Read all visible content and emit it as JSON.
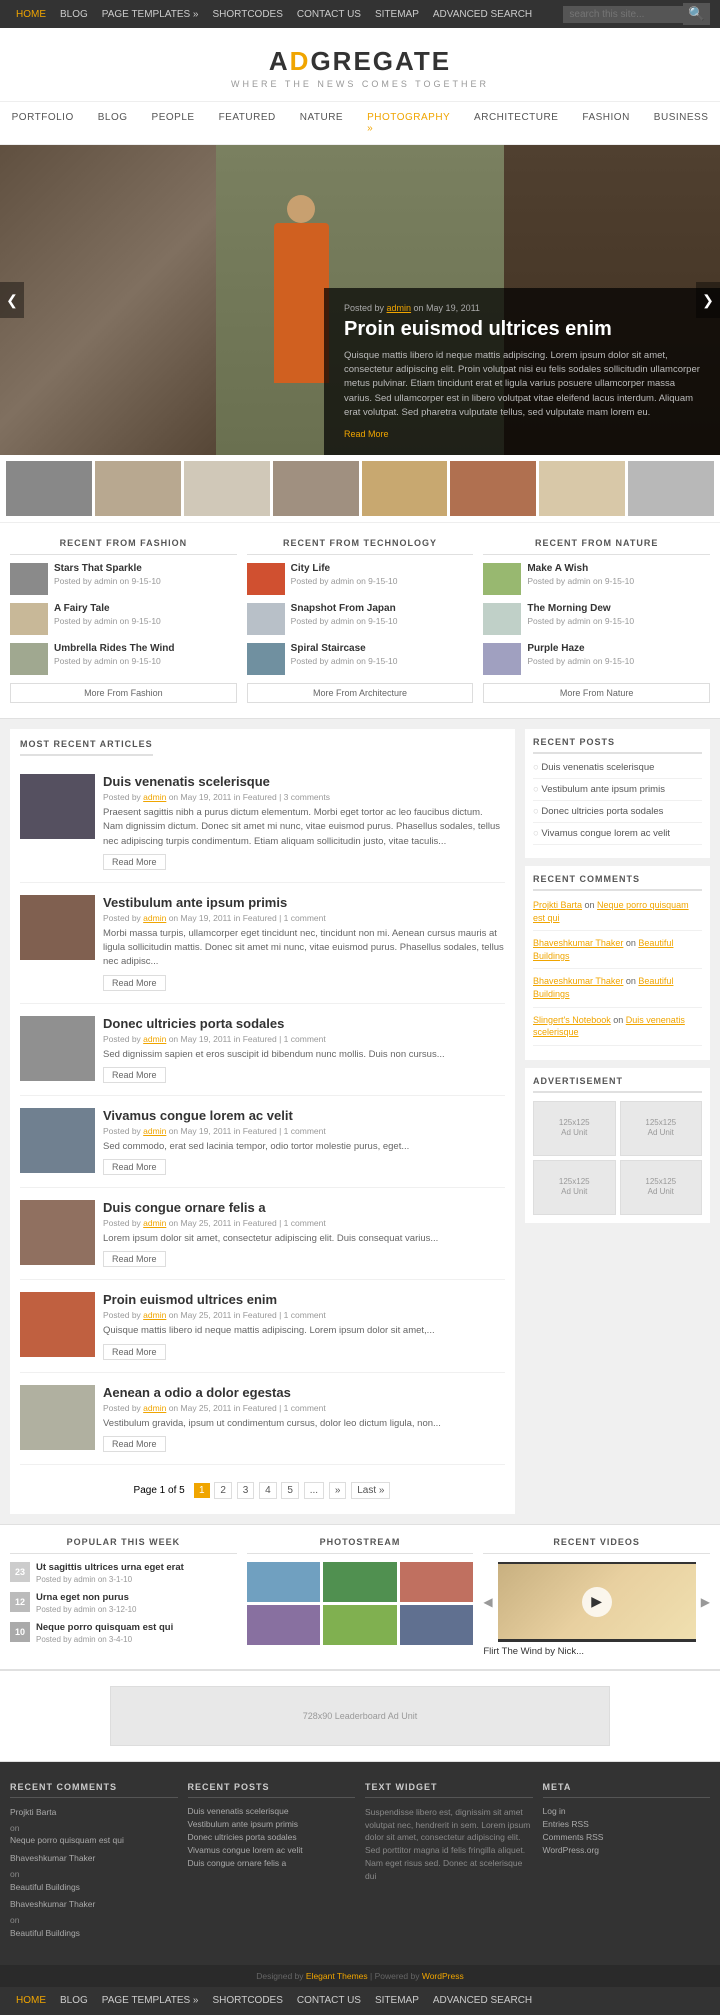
{
  "topNav": {
    "links": [
      "HOME",
      "BLOG",
      "PAGE TEMPLATES »",
      "SHORTCODES",
      "CONTACT US",
      "SITEMAP",
      "ADVANCED SEARCH"
    ],
    "activeLink": "HOME",
    "searchPlaceholder": "search this site..."
  },
  "header": {
    "logoText": "ADGREGATE",
    "logoHighlight": "D",
    "tagline": "WHERE THE NEWS COMES TOGETHER"
  },
  "mainNav": {
    "links": [
      "PORTFOLIO",
      "BLOG",
      "PEOPLE",
      "FEATURED",
      "NATURE",
      "PHOTOGRAPHY »",
      "ARCHITECTURE",
      "FASHION",
      "BUSINESS"
    ]
  },
  "hero": {
    "meta": "Posted by admin on May 19, 2011",
    "title": "Proin euismod ultrices enim",
    "description": "Quisque mattis libero id neque mattis adipiscing. Lorem ipsum dolor sit amet, consectetur adipiscing elit. Proin volutpat nisi eu felis sodales sollicitudin ullamcorper metus pulvinar. Etiam tincidunt erat et ligula varius posuere ullamcorper massa varius. Sed ullamcorper est in libero volutpat vitae eleifend lacus interdum. Aliquam erat volutpat. Sed pharetra vulputate tellus, sed vulputate mam lorem eu.",
    "readMore": "Read More"
  },
  "recentSections": {
    "fashion": {
      "title": "RECENT FROM FASHION",
      "items": [
        {
          "title": "Stars That Sparkle",
          "meta": "Posted by admin on 9-15-10"
        },
        {
          "title": "A Fairy Tale",
          "meta": "Posted by admin on 9-15-10"
        },
        {
          "title": "Umbrella Rides The Wind",
          "meta": "Posted by admin on 9-15-10"
        }
      ],
      "moreBtn": "More From Fashion"
    },
    "technology": {
      "title": "RECENT FROM TECHNOLOGY",
      "items": [
        {
          "title": "City Life",
          "meta": "Posted by admin on 9-15-10"
        },
        {
          "title": "Snapshot From Japan",
          "meta": "Posted by admin on 9-15-10"
        },
        {
          "title": "Spiral Staircase",
          "meta": "Posted by admin on 9-15-10"
        }
      ],
      "moreBtn": "More From Architecture"
    },
    "nature": {
      "title": "RECENT FROM NATURE",
      "items": [
        {
          "title": "Make A Wish",
          "meta": "Posted by admin on 9-15-10"
        },
        {
          "title": "The Morning Dew",
          "meta": "Posted by admin on 9-15-10"
        },
        {
          "title": "Purple Haze",
          "meta": "Posted by admin on 9-15-10"
        }
      ],
      "moreBtn": "More From Nature"
    }
  },
  "mainContent": {
    "sectionTitle": "MOST RECENT ARTICLES",
    "articles": [
      {
        "title": "Duis venenatis scelerisque",
        "meta": "Posted by admin on May 19, 2011 in Featured | 3 comments",
        "excerpt": "Praesent sagittis nibh a purus dictum elementum. Morbi eget tortor ac leo faucibus dictum. Nam dignissim dictum. Donec sit amet mi nunc, vitae euismod purus. Phasellus sodales, tellus nec adipiscing turpis condimentum. Etiam aliquam sollicitudin justo, vitae taculis...",
        "readMore": "Read More"
      },
      {
        "title": "Vestibulum ante ipsum primis",
        "meta": "Posted by admin on May 19, 2011 in Featured | 1 comment",
        "excerpt": "Morbi massa turpis, ullamcorper eget tincidunt nec, tincidunt non mi. Aenean cursus mauris at ligula sollicitudin mattis. Donec sit amet mi nunc, vitae euismod purus. Phasellus sodales, tellus nec adipisc...",
        "readMore": "Read More"
      },
      {
        "title": "Donec ultricies porta sodales",
        "meta": "Posted by admin on May 19, 2011 in Featured | 1 comment",
        "excerpt": "Sed dignissim sapien et eros suscipit id bibendum nunc mollis. Duis non cursus...",
        "readMore": "Read More"
      },
      {
        "title": "Vivamus congue lorem ac velit",
        "meta": "Posted by admin on May 19, 2011 in Featured | 1 comment",
        "excerpt": "Sed commodo, erat sed lacinia tempor, odio tortor molestie purus, eget...",
        "readMore": "Read More"
      },
      {
        "title": "Duis congue ornare felis a",
        "meta": "Posted by admin on May 25, 2011 in Featured | 1 comment",
        "excerpt": "Lorem ipsum dolor sit amet, consectetur adipiscing elit. Duis consequat varius...",
        "readMore": "Read More"
      },
      {
        "title": "Proin euismod ultrices enim",
        "meta": "Posted by admin on May 25, 2011 in Featured | 1 comment",
        "excerpt": "Quisque mattis libero id neque mattis adipiscing. Lorem ipsum dolor sit amet,...",
        "readMore": "Read More"
      },
      {
        "title": "Aenean a odio a dolor egestas",
        "meta": "Posted by admin on May 25, 2011 in Featured | 1 comment",
        "excerpt": "Vestibulum gravida, ipsum ut condimentum cursus, dolor leo dictum ligula, non...",
        "readMore": "Read More"
      }
    ],
    "pagination": {
      "text": "Page 1 of 5",
      "pages": [
        "1",
        "2",
        "3",
        "4",
        "5",
        "...",
        "»",
        "Last »"
      ]
    }
  },
  "sidebar": {
    "recentPostsTitle": "RECENT POSTS",
    "recentPosts": [
      "Duis venenatis scelerisque",
      "Vestibulum ante ipsum primis",
      "Donec ultricies porta sodales",
      "Vivamus congue lorem ac velit"
    ],
    "recentCommentsTitle": "RECENT COMMENTS",
    "recentComments": [
      {
        "author": "Projkti Barta",
        "link": "Neque porro quisquam est qui"
      },
      {
        "author": "Bhaveshkumar Thaker",
        "link": "Beautiful Buildings"
      },
      {
        "author": "Bhaveshkumar Thaker",
        "link": "Beautiful Buildings"
      },
      {
        "author": "Slingert's Notebook",
        "link": "Duis venenatis scelerisque"
      }
    ],
    "advertisementTitle": "ADVERTISEMENT",
    "adUnits": [
      "125x125\nAd Unit",
      "125x125\nAd Unit",
      "125x125\nAd Unit",
      "125x125\nAd Unit"
    ]
  },
  "bottomSections": {
    "popular": {
      "title": "POPULAR THIS WEEK",
      "items": [
        {
          "num": "23",
          "title": "Ut sagittis ultrices urna eget erat",
          "meta": "Posted by admin on 3-1-10"
        },
        {
          "num": "12",
          "title": "Urna eget non purus",
          "meta": "Posted by admin on 3-12-10"
        },
        {
          "num": "10",
          "title": "Neque porro quisquam est qui",
          "meta": "Posted by admin on 3-4-10"
        }
      ]
    },
    "photostream": {
      "title": "PHOTOSTREAM"
    },
    "recentVideos": {
      "title": "RECENT VIDEOS",
      "videoTitle": "Flirt The Wind by Nick..."
    }
  },
  "adBanner": {
    "text": "728x90 Leaderboard Ad Unit"
  },
  "footer": {
    "cols": [
      {
        "title": "RECENT COMMENTS",
        "items": [
          "Projkti Barta on Neque porro quisquam est qui",
          "Bhaveshkumar Thaker on Beautiful Buildings",
          "Bhaveshkumar Thaker on Beautiful Buildings"
        ]
      },
      {
        "title": "RECENT POSTS",
        "items": [
          "Duis venenatis scelerisque",
          "Vestibulum ante ipsum primis",
          "Donec ultricies porta sodales",
          "Vivamus congue lorem ac velit",
          "Duis congue ornare felis a"
        ]
      },
      {
        "title": "TEXT WIDGET",
        "text": "Suspendisse libero est, dignissim sit amet volutpat nec, hendrerit in sem. Lorem ipsum dolor sit amet, consectetur adipiscing elit. Sed porttitor magna id felis fringilla aliquet. Nam eget risus sed. Donec at scelerisque dui"
      },
      {
        "title": "META",
        "items": [
          "Log in",
          "Entries RSS",
          "Comments RSS",
          "WordPress.org"
        ]
      }
    ],
    "credit": "Designed by Elegant Themes | Powered by WordPress"
  },
  "bottomNav": {
    "links": [
      "HOME",
      "BLOG",
      "PAGE TEMPLATES »",
      "SHORTCODES",
      "CONTACT US",
      "SITEMAP",
      "ADVANCED SEARCH"
    ],
    "activeLink": "HOME"
  }
}
